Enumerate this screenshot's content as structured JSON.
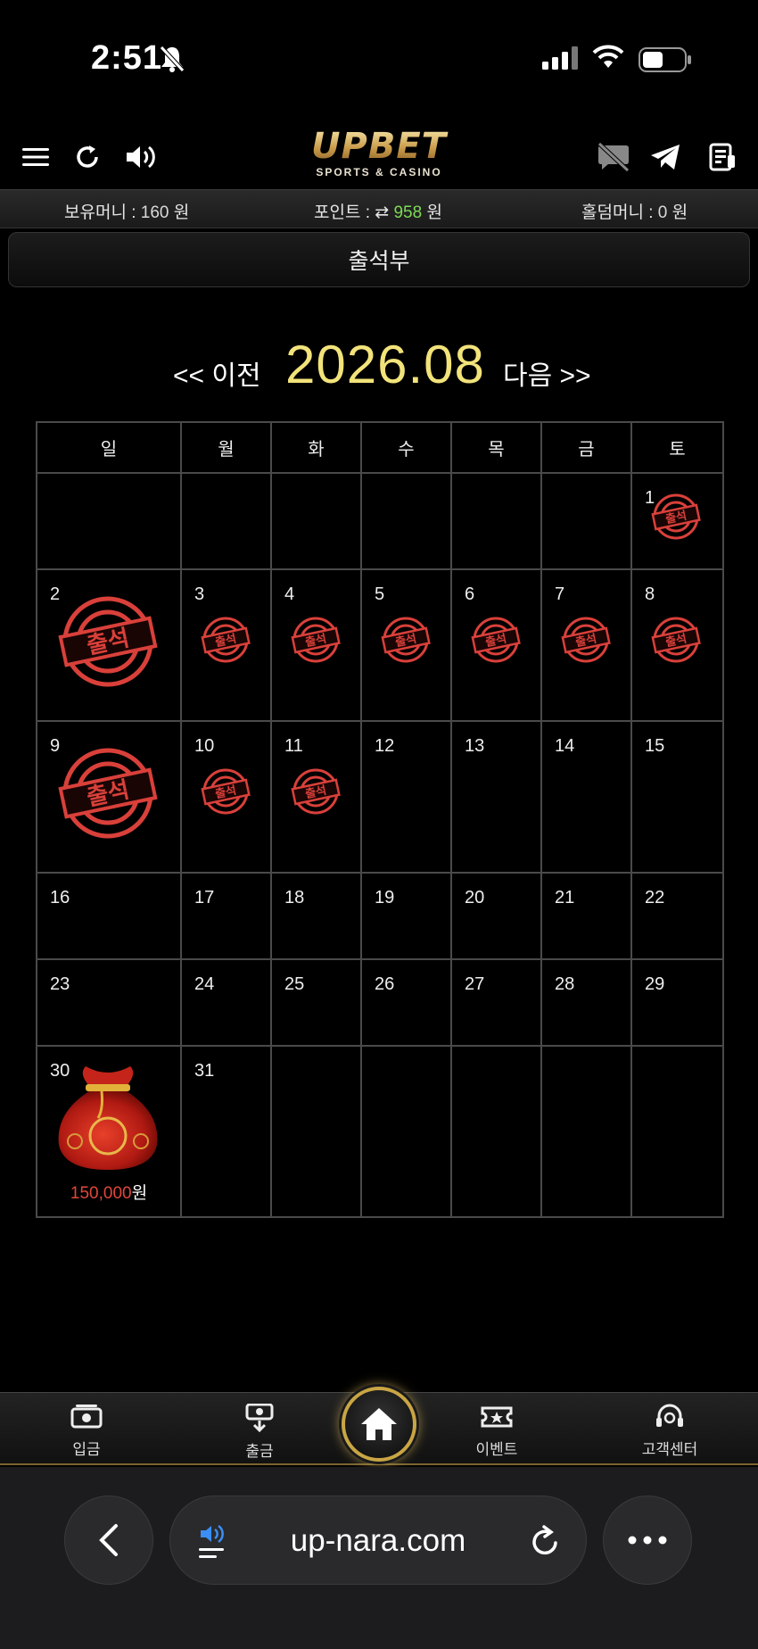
{
  "status_bar": {
    "time": "2:51"
  },
  "brand": {
    "name": "UPBET",
    "tagline": "SPORTS & CASINO"
  },
  "balance": {
    "money_label": "보유머니 :",
    "money_value": "160",
    "money_unit": "원",
    "point_label": "포인트 :",
    "point_value": "958",
    "point_unit": "원",
    "holdem_label": "홀덤머니 :",
    "holdem_value": "0",
    "holdem_unit": "원"
  },
  "page_title": "출석부",
  "month_nav": {
    "prev": "<< 이전",
    "current": "2026.08",
    "next": "다음 >>"
  },
  "calendar": {
    "weekdays": [
      "일",
      "월",
      "화",
      "수",
      "목",
      "금",
      "토"
    ],
    "stamp_text": "출석",
    "weeks": [
      [
        "",
        "",
        "",
        "",
        "",
        "",
        "1"
      ],
      [
        "2",
        "3",
        "4",
        "5",
        "6",
        "7",
        "8"
      ],
      [
        "9",
        "10",
        "11",
        "12",
        "13",
        "14",
        "15"
      ],
      [
        "16",
        "17",
        "18",
        "19",
        "20",
        "21",
        "22"
      ],
      [
        "23",
        "24",
        "25",
        "26",
        "27",
        "28",
        "29"
      ],
      [
        "30",
        "31",
        "",
        "",
        "",
        "",
        ""
      ]
    ],
    "attended_days": [
      1,
      2,
      3,
      4,
      5,
      6,
      7,
      8,
      9,
      10,
      11
    ],
    "large_stamp_days": [
      2,
      9
    ],
    "reward": {
      "day": "30",
      "amount": "150,000",
      "unit": "원"
    }
  },
  "bottom_nav": {
    "deposit": "입금",
    "withdraw": "출금",
    "events": "이벤트",
    "support": "고객센터"
  },
  "browser": {
    "url": "up-nara.com"
  },
  "colors": {
    "accent_gold": "#c9a544",
    "month_yellow": "#f2e37a",
    "stamp_red": "#d9403a",
    "point_green": "#7ed957"
  }
}
